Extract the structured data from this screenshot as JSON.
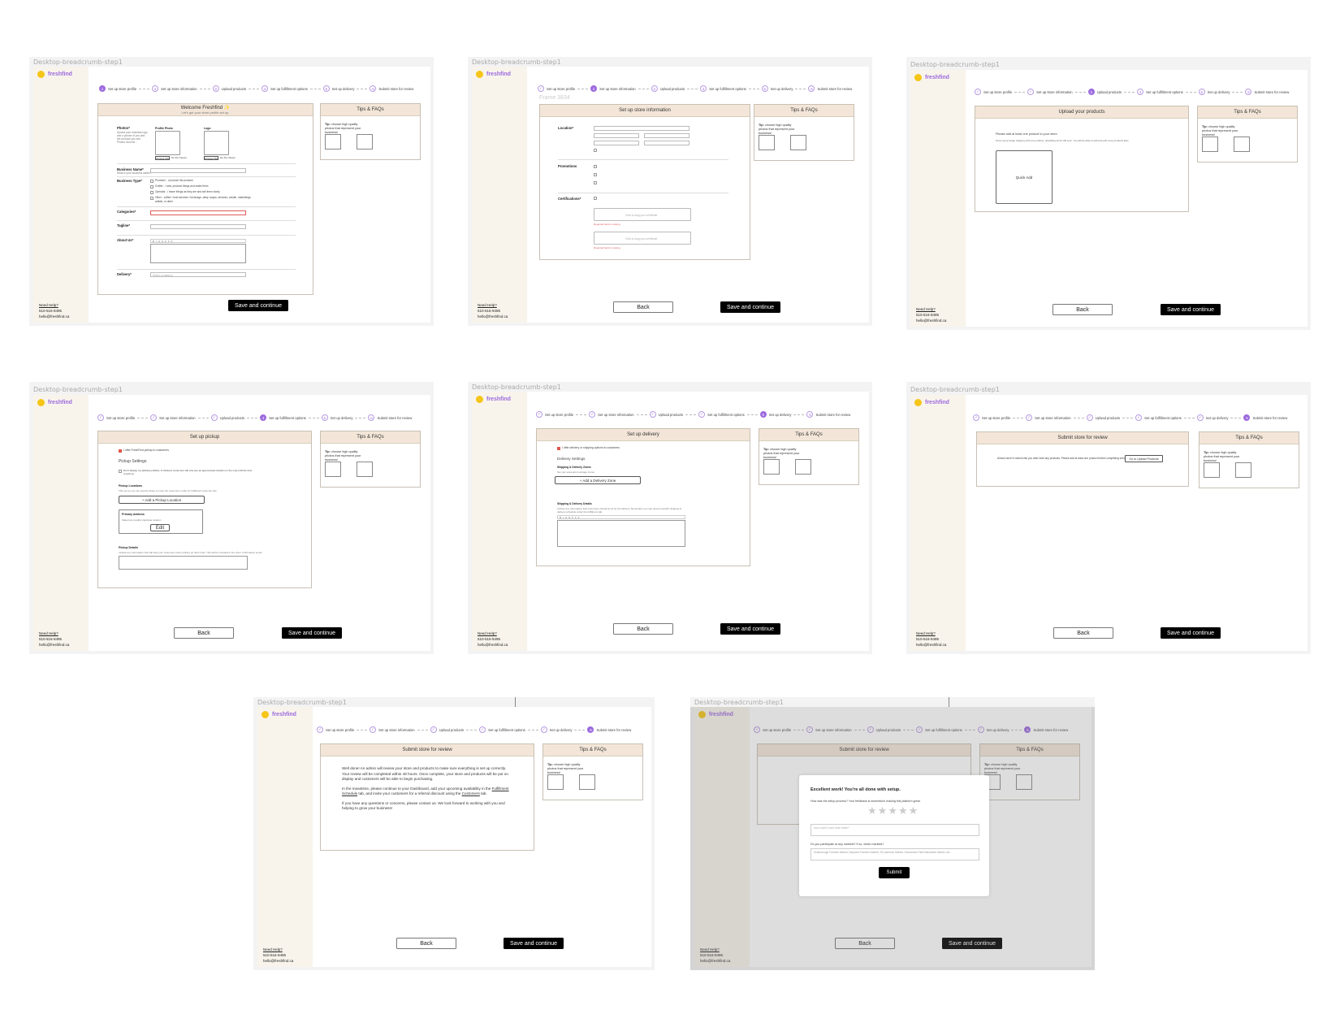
{
  "frame_label": "Desktop-breadcrumb-step1",
  "frame_label_alt": "Frame 3834",
  "brand": {
    "name": "freshfind",
    "accent": "#9c6ade",
    "sun": "#f5c518"
  },
  "help": {
    "title": "Need Help?",
    "phone": "510-516-9495",
    "email": "hello@freshfind.ca"
  },
  "steps": [
    "Set up store profile",
    "Set up store information",
    "Upload products",
    "Set up fulfillment options",
    "Set up delivery",
    "Submit store for review"
  ],
  "buttons": {
    "save": "Save and continue",
    "back": "Back"
  },
  "tips": {
    "title": "Tips & FAQs",
    "tip_label": "Tip:",
    "tip_text": "choose high quality photos that represent your business!"
  },
  "step1": {
    "title": "Welcome Freshfind ✨",
    "subtitle": "Let's get your store profile set up.",
    "photos_label": "Photos*",
    "photos_desc": "Upload your business logo and a picture of you and the produce you sell. Photos must be...",
    "profile_photo": "Profile Photo",
    "logo": "Logo",
    "choose_file": "Choose File",
    "no_file": "No file chosen",
    "business_name": "Business Name*",
    "business_name_desc": "What is your business called?",
    "business_type": "Business Type*",
    "types": [
      "Producer - I produce the produce",
      "Crafter - I sew, produce things and make them",
      "Operator - I leave things as they are and sell them nicely",
      "Other - coffee / food services / beverage, dairy, soaps, services, candle, marketings, artistic, or other"
    ],
    "categories": "Categories*",
    "tagline": "Tagline*",
    "about": "About Us*",
    "delivery": "Delivery*",
    "select_hint": "Select a category"
  },
  "step2": {
    "title": "Set up store information",
    "location": "Location*",
    "promotions": "Promotions",
    "certifications": "Certifications*",
    "no_file": "Click to drag your certificate",
    "error": "Required field is missing"
  },
  "step3": {
    "title": "Upload your products",
    "line1": "Please add at least one product to your store.",
    "line2": "Once every single category with one product, uploading items will sync. You will be able to add and edit more products later.",
    "quick_add": "Quick Add"
  },
  "step4": {
    "title": "Set up pickup",
    "offer": "I offer FreshFind pickup to customers",
    "settings": "Pickup Settings",
    "display": "Don't display my address publicly. If checked, customers will only see an approximate location on the map until the time to pick up.",
    "locations": "Pickup Locations",
    "locations_desc": "This set up you can specify where to meet the customer's order for fulfillment customer site.",
    "add": "+ Add a Pickup Location",
    "primary": "Primary Address",
    "primary_desc": "Stated as possibly duplicate location",
    "edit": "Edit",
    "details": "Pickup Details",
    "details_desc": "Include any information that will help your customers when picking up their order. This will be included in the order confirmation email."
  },
  "step5": {
    "title": "Set up delivery",
    "offer": "I offer delivery or shipping options to customers",
    "settings": "Delivery Settings",
    "zones": "Shipping & Delivery Zones",
    "zones_desc": "Set your area and coverage zones",
    "add": "+ Add a Delivery Zone",
    "details": "Shipping & Delivery Details",
    "details_desc": "Include any information that customers should know for the delivery. Remember you can access specific shipping & delivery schedule under the fulfillment tab."
  },
  "step6": {
    "title": "Submit store for review",
    "text": "Almost done! It seems like you didn't add any products. Please add at least one product before completing setup.",
    "link": "Go to Upload Products"
  },
  "step7": {
    "title": "Submit store for review",
    "p1": "Well done! An admin will review your store and products to make sure everything is set up correctly. Your review will be completed within 48 hours. Once complete, your store and products will be put on display and customers will be able to begin purchasing.",
    "p2a": "In the meantime, please continue to your Dashboard, add your upcoming availability in the ",
    "p2link1": "Fulfillment Schedule",
    "p2b": " tab, and invite your customers for a referral discount using the ",
    "p2link2": "Customers",
    "p2c": " tab.",
    "p3": "If you have any questions or concerns, please contact us. We look forward to working with you and helping to grow your business!"
  },
  "modal": {
    "title": "Excellent work! You're all done with setup.",
    "question": "How was the setup process? Your feedback is essential in making this platform great.",
    "better_placeholder": "How could it have been better?",
    "markets_q": "Do you participate at any markets? If so, which markets?",
    "markets_placeholder": "Scarborough Farmers Market, Nepanee Farmers Market, St Lawrence Market, Downsview Park Merchants Market, etc",
    "submit": "Submit",
    "stars": [
      "★",
      "★",
      "★",
      "★",
      "★"
    ]
  }
}
